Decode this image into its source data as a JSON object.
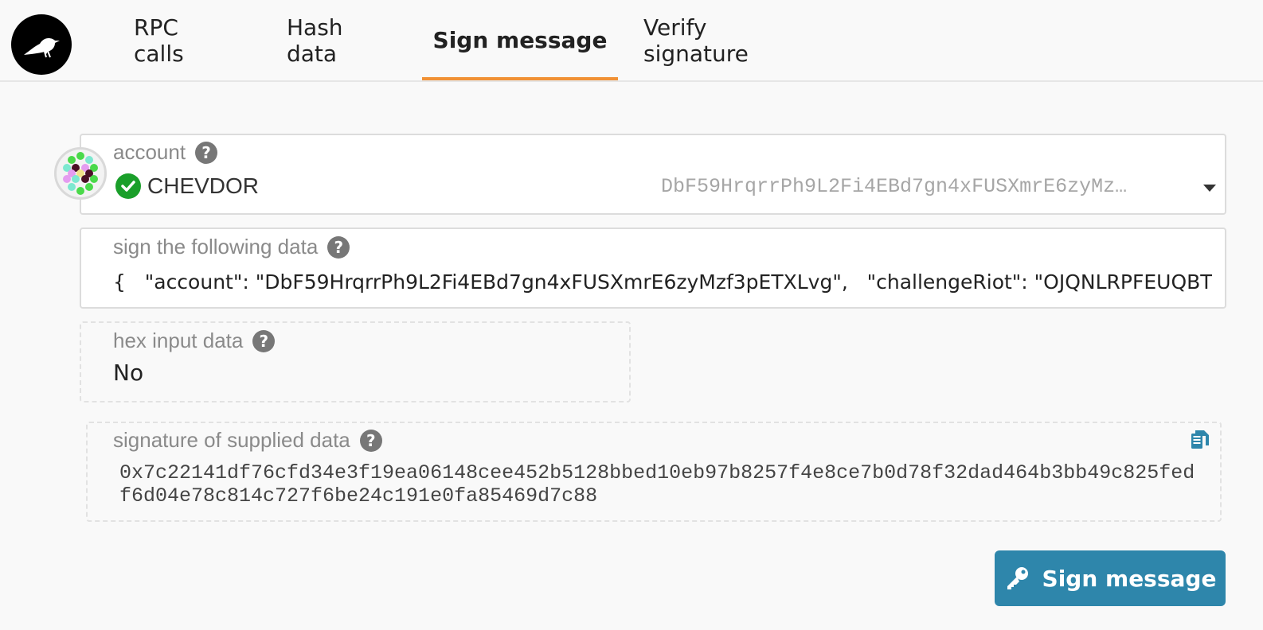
{
  "nav": {
    "tabs": [
      {
        "label": "RPC calls",
        "active": false
      },
      {
        "label": "Hash data",
        "active": false
      },
      {
        "label": "Sign message",
        "active": true
      },
      {
        "label": "Verify signature",
        "active": false
      }
    ]
  },
  "account": {
    "label": "account",
    "name": "CHEVDOR",
    "address": "DbF59HrqrrPh9L2Fi4EBd7gn4xFUSXmrE6zyMz…",
    "verified": true
  },
  "sign_data": {
    "label": "sign the following data",
    "value": "{   \"account\": \"DbF59HrqrrPh9L2Fi4EBd7gn4xFUSXmrE6zyMzf3pETXLvg\",   \"challengeRiot\": \"OJQNLRPFEUQBTG"
  },
  "hex_input": {
    "label": "hex input data",
    "value": "No"
  },
  "signature": {
    "label": "signature of supplied data",
    "value": "0x7c22141df76cfd34e3f19ea06148cee452b5128bbed10eb97b8257f4e8ce7b0d78f32dad464b3bb49c825fedf6d04e78c814c727f6be24c191e0fa85469d7c88"
  },
  "actions": {
    "sign_label": "Sign message"
  },
  "colors": {
    "accent_underline": "#f19135",
    "button": "#2e86ab",
    "verified": "#1a9f2a"
  },
  "icons": [
    "raven-logo-icon",
    "identicon-avatar",
    "check-circle-icon",
    "help-icon",
    "chevron-down-icon",
    "copy-icon",
    "key-icon"
  ]
}
